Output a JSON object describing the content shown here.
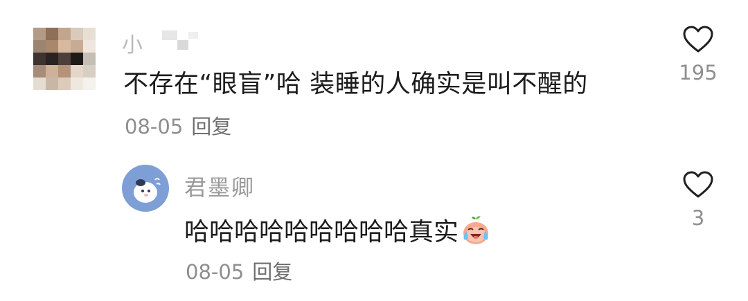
{
  "comments": [
    {
      "username": "小",
      "text": "不存在“眼盲”哈 装睡的人确实是叫不醒的",
      "date": "08-05",
      "reply_label": "回复",
      "like_icon": "heart-outline-icon",
      "likes": "195",
      "avatar": "pixelated-avatar"
    },
    {
      "username": "君墨卿",
      "text": "哈哈哈哈哈哈哈哈哈真实",
      "emoji": "crying-laughing-emoji",
      "date": "08-05",
      "reply_label": "回复",
      "like_icon": "heart-outline-icon",
      "likes": "3",
      "avatar": "cartoon-avatar"
    }
  ],
  "colors": {
    "text": "#1c1c1c",
    "secondary": "#8e8e8e",
    "username": "#9a9a9a",
    "avatar_bg": "#7d9fd6"
  }
}
